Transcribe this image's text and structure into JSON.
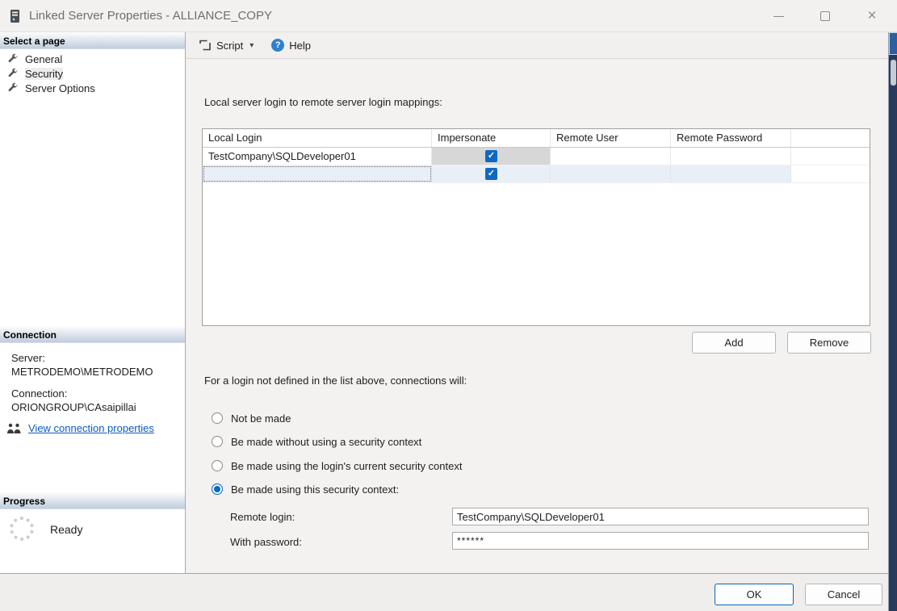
{
  "window": {
    "title": "Linked Server Properties - ALLIANCE_COPY",
    "controls": {
      "minimize": "minimize",
      "maximize": "maximize",
      "close": "×"
    }
  },
  "sidebar": {
    "select_page": {
      "header": "Select a page",
      "items": [
        {
          "label": "General",
          "selected": false
        },
        {
          "label": "Security",
          "selected": true
        },
        {
          "label": "Server Options",
          "selected": false
        }
      ]
    },
    "connection": {
      "header": "Connection",
      "server_label": "Server:",
      "server_value": "METRODEMO\\METRODEMO",
      "connection_label": "Connection:",
      "connection_value": "ORIONGROUP\\CAsaipillai",
      "link_label": "View connection properties"
    },
    "progress": {
      "header": "Progress",
      "status": "Ready"
    }
  },
  "toolbar": {
    "script_label": "Script",
    "caret": "▾",
    "help_label": "Help",
    "help_glyph": "?"
  },
  "main": {
    "mappings_label": "Local server login to remote server login mappings:",
    "table": {
      "columns": [
        "Local Login",
        "Impersonate",
        "Remote User",
        "Remote Password"
      ],
      "rows": [
        {
          "local_login": "TestCompany\\SQLDeveloper01",
          "impersonate": true,
          "remote_user": "",
          "remote_password": ""
        },
        {
          "local_login": "",
          "impersonate": true,
          "remote_user": "",
          "remote_password": ""
        }
      ]
    },
    "add_label": "Add",
    "remove_label": "Remove",
    "radio_group_label": "For a login not defined in the list above, connections will:",
    "radios": [
      {
        "label": "Not be made",
        "selected": false
      },
      {
        "label": "Be made without using a security context",
        "selected": false
      },
      {
        "label": "Be made using the login's current security context",
        "selected": false
      },
      {
        "label": "Be made using this security context:",
        "selected": true
      }
    ],
    "remote_login_label": "Remote login:",
    "remote_login_value": "TestCompany\\SQLDeveloper01",
    "password_label": "With password:",
    "password_value": "******"
  },
  "footer": {
    "ok_label": "OK",
    "cancel_label": "Cancel"
  },
  "icons": {
    "check": "✓"
  },
  "colors": {
    "accent": "#0b69c7",
    "checkbox": "#1168c2",
    "link": "#0a5bc4",
    "strip": "#29395c"
  }
}
